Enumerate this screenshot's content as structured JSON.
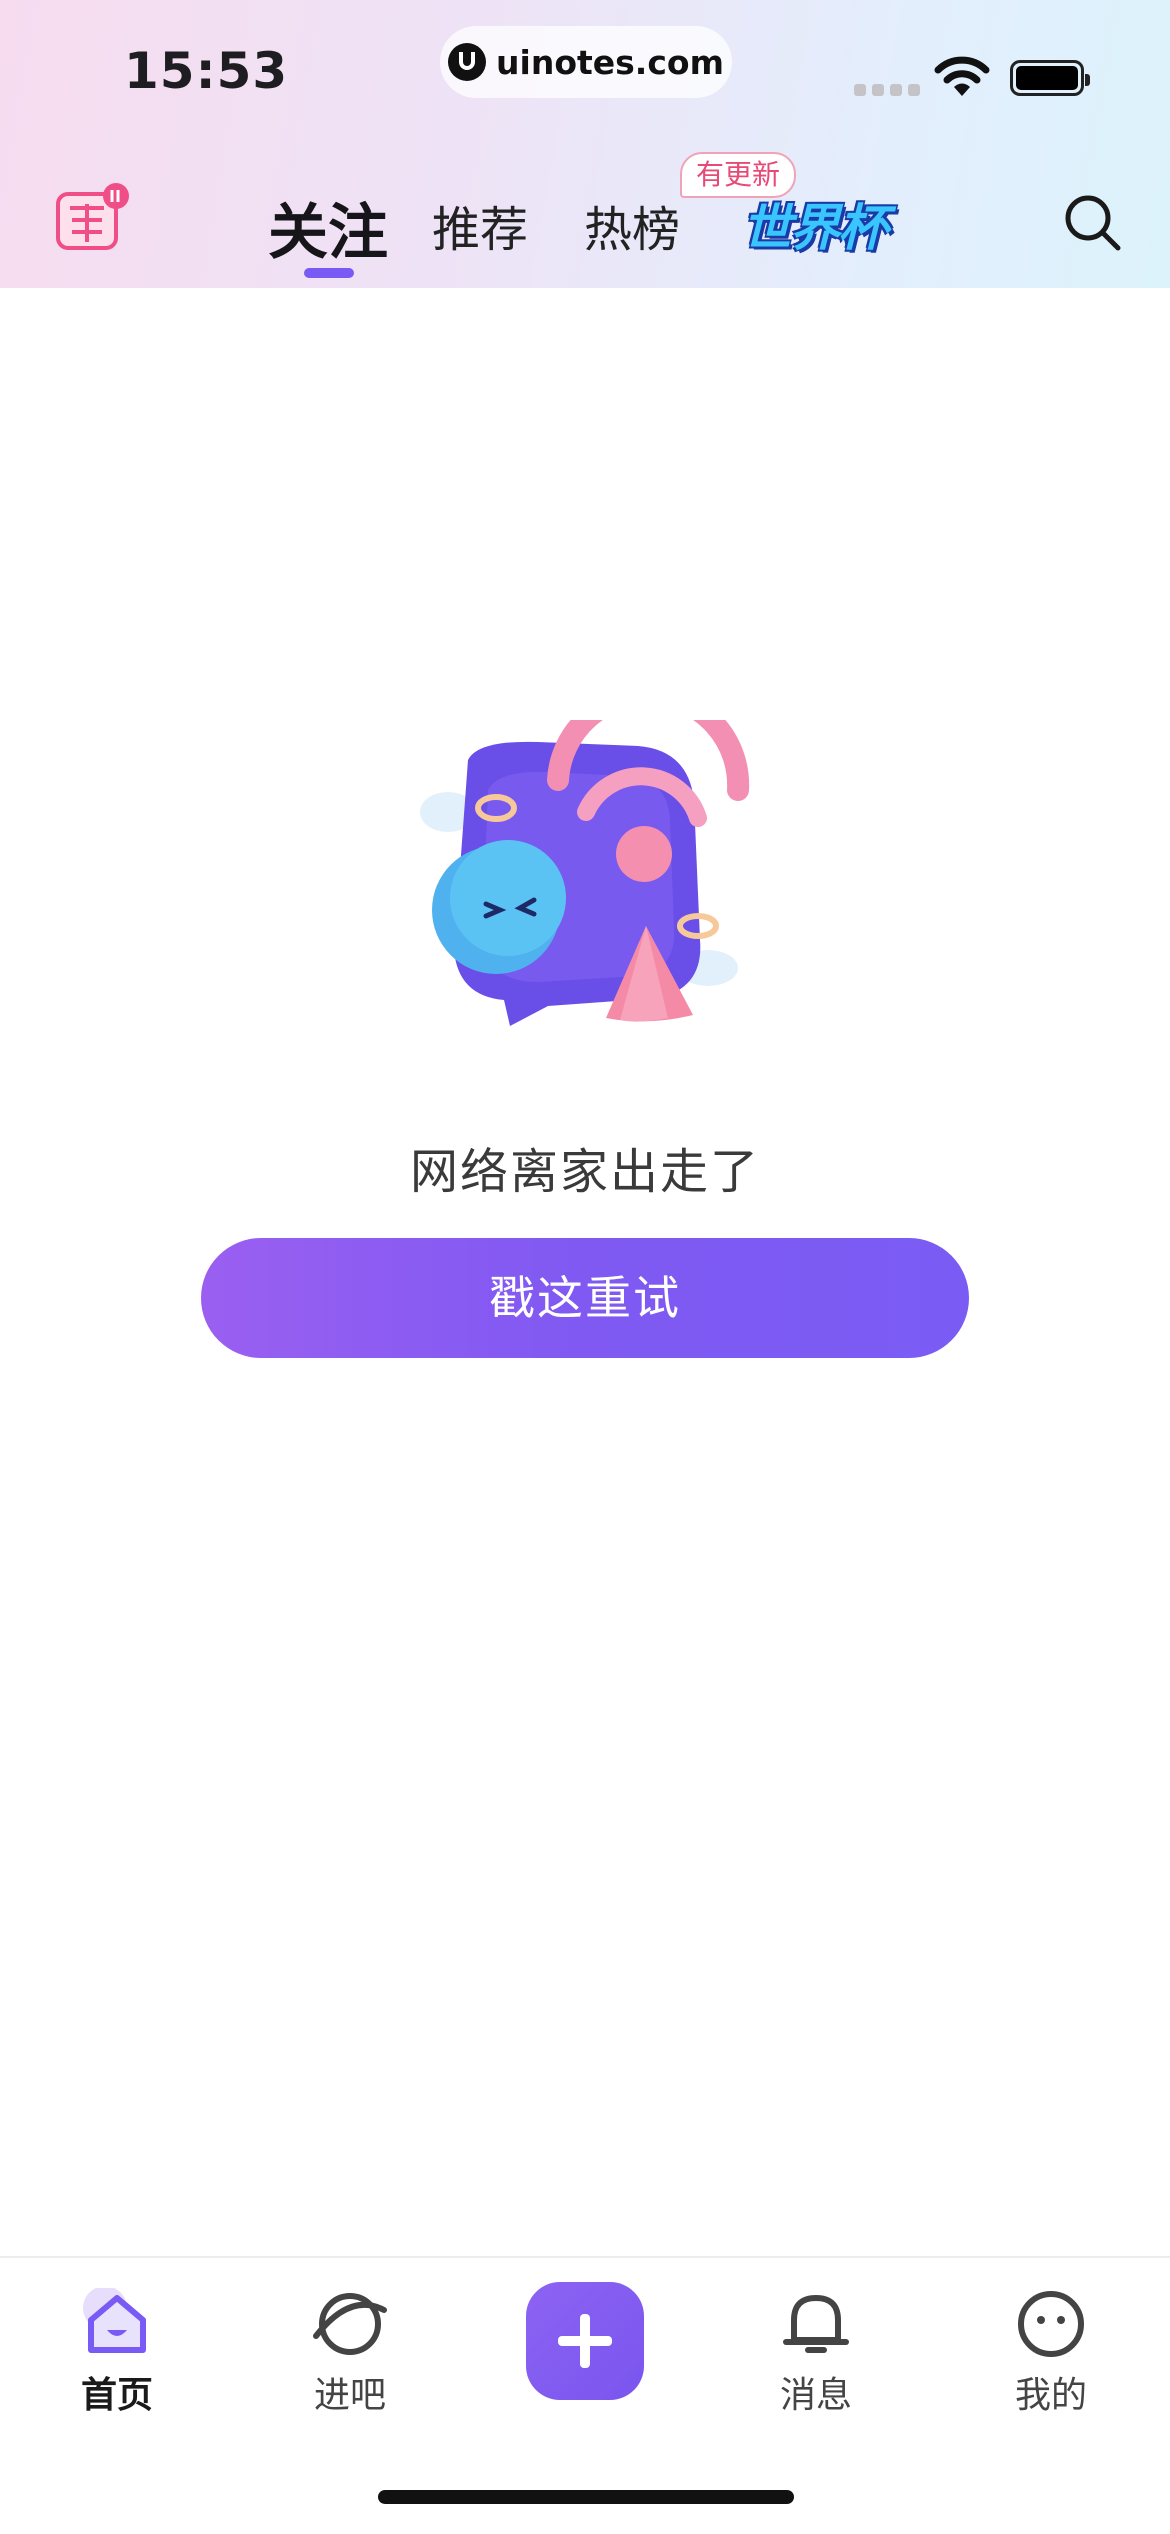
{
  "status_bar": {
    "time": "15:53",
    "url": "uinotes.com"
  },
  "header": {
    "live_logo_icon": "live-broadcast-logo-icon",
    "tabs": [
      {
        "label": "关注",
        "active": true
      },
      {
        "label": "推荐",
        "active": false
      },
      {
        "label": "热榜",
        "active": false
      }
    ],
    "update_badge": "有更新",
    "worldcup_label": "世界杯",
    "search_icon": "search-icon",
    "accent_color": "#7a5af5"
  },
  "empty_state": {
    "illustration": "network-offline-illustration",
    "message": "网络离家出走了",
    "retry_label": "戳这重试"
  },
  "tabbar": {
    "items": [
      {
        "label": "首页",
        "icon": "home-icon",
        "active": true
      },
      {
        "label": "进吧",
        "icon": "planet-icon",
        "active": false
      },
      {
        "label": "",
        "icon": "plus-icon",
        "active": false
      },
      {
        "label": "消息",
        "icon": "bell-icon",
        "active": false
      },
      {
        "label": "我的",
        "icon": "profile-face-icon",
        "active": false
      }
    ]
  }
}
